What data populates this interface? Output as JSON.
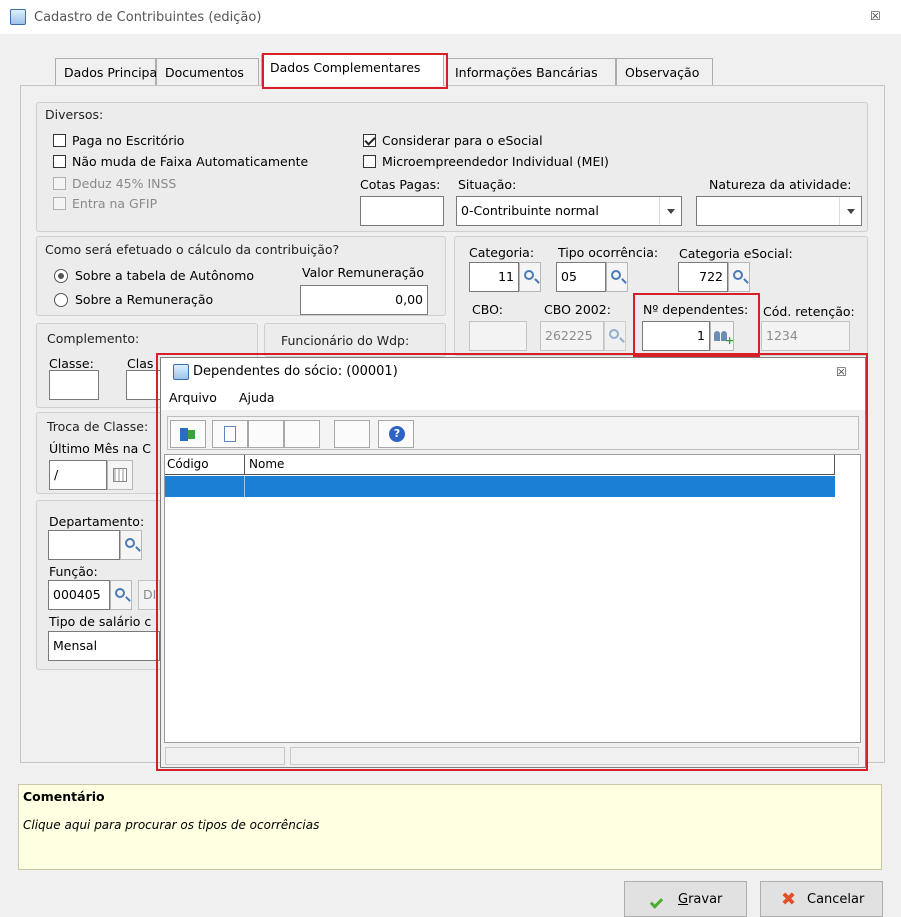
{
  "window": {
    "title": "Cadastro de Contribuintes (edição)",
    "close": "☒"
  },
  "tabs": [
    "Dados Principais",
    "Documentos",
    "Dados Complementares",
    "Informações Bancárias",
    "Observação"
  ],
  "diversos": {
    "title": "Diversos:",
    "paga_escritorio": "Paga no Escritório",
    "nao_muda_faixa": "Não muda de Faixa Automaticamente",
    "deduz_inss": "Deduz 45% INSS",
    "entra_gfip": "Entra na GFIP",
    "considerar_esocial": "Considerar para o eSocial",
    "mei": "Microempreendedor Individual (MEI)",
    "cotas_pagas_label": "Cotas Pagas:",
    "cotas_pagas_value": "",
    "situacao_label": "Situação:",
    "situacao_value": "0-Contribuinte normal",
    "natureza_label": "Natureza da atividade:",
    "natureza_value": ""
  },
  "calculo": {
    "title": "Como será efetuado o cálculo da contribuição?",
    "opt_tabela": "Sobre a tabela de Autônomo",
    "opt_remuneracao": "Sobre a Remuneração",
    "valor_label": "Valor Remuneração",
    "valor": "0,00"
  },
  "categoria": {
    "categoria_label": "Categoria:",
    "categoria_value": "11",
    "tipo_ocorrencia_label": "Tipo ocorrência:",
    "tipo_ocorrencia_value": "05",
    "cat_esocial_label": "Categoria eSocial:",
    "cat_esocial_value": "722",
    "cbo_label": "CBO:",
    "cbo_value": "",
    "cbo2002_label": "CBO 2002:",
    "cbo2002_value": "262225",
    "dependentes_label": "Nº dependentes:",
    "dependentes_value": "1",
    "cod_retencao_label": "Cód. retenção:",
    "cod_retencao_value": "1234"
  },
  "complemento": {
    "title": "Complemento:",
    "classe_label": "Classe:",
    "clas_label": "Clas"
  },
  "funcionario_wdp": {
    "title": "Funcionário do Wdp:"
  },
  "troca_classe": {
    "title": "Troca de Classe:",
    "ultimo_mes_label": "Último Mês na C",
    "ultimo_mes_value": "/"
  },
  "outros": {
    "departamento_label": "Departamento:",
    "funcao_label": "Função:",
    "funcao_value": "000405",
    "funcao_desc": "DI",
    "tipo_salario_label": "Tipo de salário c",
    "tipo_salario_value": "Mensal"
  },
  "dialog": {
    "title": "Dependentes do sócio: (00001)",
    "close": "☒",
    "menu": [
      "Arquivo",
      "Ajuda"
    ],
    "columns": [
      "Código",
      "Nome"
    ],
    "rows": [
      {
        "codigo": "",
        "nome": ""
      }
    ]
  },
  "comment": {
    "title": "Comentário",
    "text": "Clique aqui para procurar os tipos de ocorrências"
  },
  "buttons": {
    "gravar_pre": "",
    "gravar_u": "G",
    "gravar_rest": "ravar",
    "cancelar": "Cancelar"
  },
  "colors": {
    "highlight": "#d81f26",
    "selection": "#1c7fd6",
    "comment_bg": "#ffffe1"
  }
}
